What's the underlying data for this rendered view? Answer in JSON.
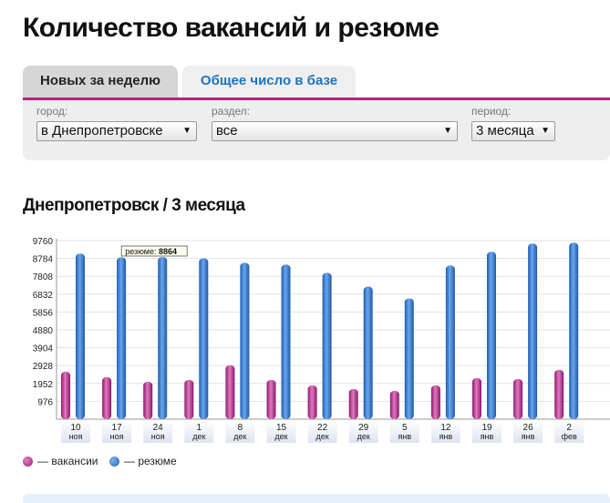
{
  "page": {
    "title": "Количество вакансий и резюме"
  },
  "tabs": [
    {
      "label": "Новых за неделю",
      "active": true
    },
    {
      "label": "Общее число в базе",
      "active": false
    }
  ],
  "filters": {
    "city": {
      "label": "город:",
      "value": "в Днепропетровске"
    },
    "section": {
      "label": "раздел:",
      "value": "все"
    },
    "period": {
      "label": "период:",
      "value": "3 месяца"
    }
  },
  "chart_heading": "Днепропетровск / 3 месяца",
  "legend": {
    "vacancies": "— вакансии",
    "resumes": "— резюме"
  },
  "tooltip": {
    "series_label": "резюме:",
    "value": "8864"
  },
  "colors": {
    "accent": "#b6237f",
    "link": "#1e73be",
    "vacancies": "#b0288a",
    "resumes": "#2a6fc9"
  },
  "chart_data": {
    "type": "bar",
    "title": "Днепропетровск / 3 месяца",
    "categories": [
      [
        "10",
        "ноя"
      ],
      [
        "17",
        "ноя"
      ],
      [
        "24",
        "ноя"
      ],
      [
        "1",
        "дек"
      ],
      [
        "8",
        "дек"
      ],
      [
        "15",
        "дек"
      ],
      [
        "22",
        "дек"
      ],
      [
        "29",
        "дек"
      ],
      [
        "5",
        "янв"
      ],
      [
        "12",
        "янв"
      ],
      [
        "19",
        "янв"
      ],
      [
        "26",
        "янв"
      ],
      [
        "2",
        "фев"
      ]
    ],
    "series": [
      {
        "name": "вакансии",
        "values": [
          2600,
          2300,
          2050,
          2150,
          2950,
          2150,
          1850,
          1650,
          1550,
          1850,
          2250,
          2200,
          2700
        ]
      },
      {
        "name": "резюме",
        "values": [
          9050,
          8850,
          8864,
          8800,
          8550,
          8450,
          8000,
          7250,
          6600,
          8400,
          9150,
          9600,
          9650
        ]
      }
    ],
    "yticks": [
      976,
      1952,
      2928,
      3904,
      4880,
      5856,
      6832,
      7808,
      8784,
      9760
    ],
    "ylim": [
      0,
      9760
    ],
    "grid": true,
    "legend_position": "bottom-left"
  }
}
